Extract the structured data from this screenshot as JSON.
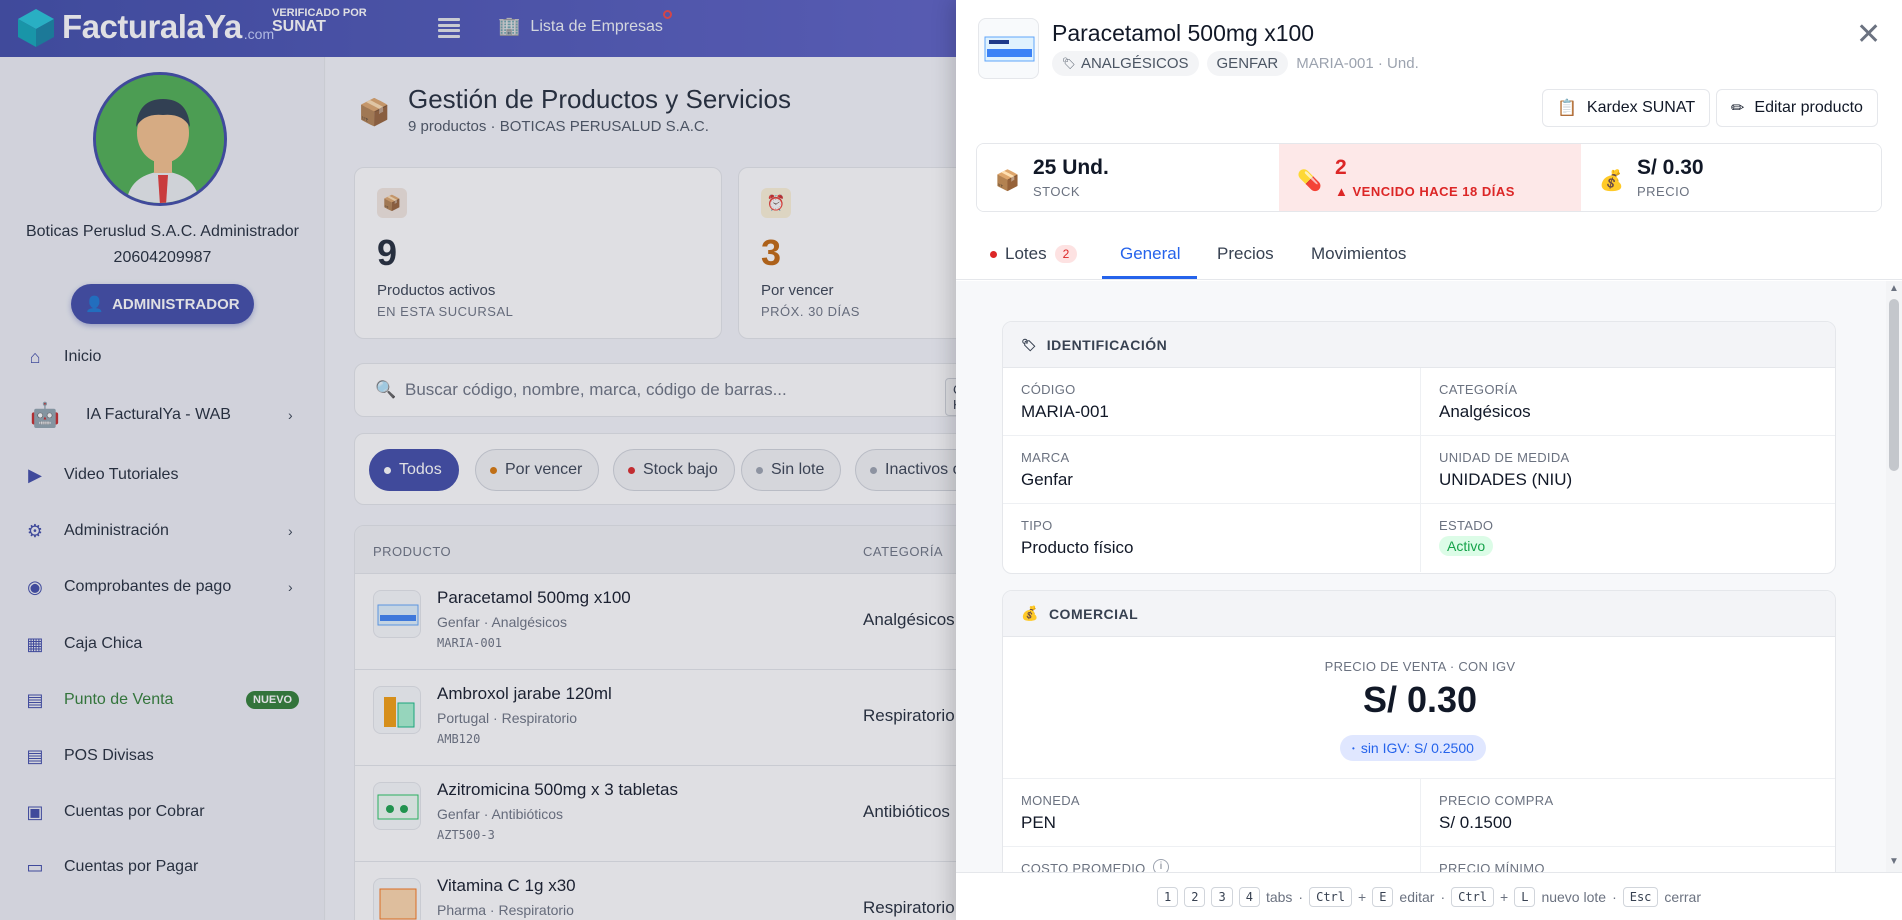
{
  "brand": {
    "name": "FacturalaYa",
    "suffix": ".com",
    "verified_line1": "VERIFICADO POR",
    "verified_line2": "SUNAT"
  },
  "topbar": {
    "empresas_label": "Lista de Empresas"
  },
  "sidebar": {
    "company_name": "Boticas Peruslud S.A.C. Administrador",
    "ruc": "20604209987",
    "role_button": "ADMINISTRADOR",
    "items": [
      {
        "label": "Inicio",
        "icon": "home-icon"
      },
      {
        "label": "IA FacturalYa - WAB",
        "icon": "robot-icon"
      },
      {
        "label": "Video Tutoriales",
        "icon": "video-icon"
      },
      {
        "label": "Administración",
        "icon": "gear-icon"
      },
      {
        "label": "Comprobantes de pago",
        "icon": "eye-icon"
      },
      {
        "label": "Caja Chica",
        "icon": "calculator-icon"
      },
      {
        "label": "Punto de Venta",
        "icon": "store-icon",
        "badge": "NUEVO"
      },
      {
        "label": "POS Divisas",
        "icon": "store-icon"
      },
      {
        "label": "Cuentas por Cobrar",
        "icon": "cash-icon"
      },
      {
        "label": "Cuentas por Pagar",
        "icon": "card-icon"
      }
    ]
  },
  "main": {
    "title": "Gestión de Productos y Servicios",
    "subtitle": "9 productos · BOTICAS PERUSALUD S.A.C.",
    "kpis": [
      {
        "value": "9",
        "label": "Productos activos",
        "sub": "EN ESTA SUCURSAL",
        "color": "#1f2937"
      },
      {
        "value": "3",
        "label": "Por vencer",
        "sub": "PRÓX. 30 DÍAS",
        "color": "#c2660a"
      }
    ],
    "search_placeholder": "Buscar código, nombre, marca, código de barras...",
    "search_shortcut": "Ctrl K",
    "filters": [
      {
        "label": "Todos",
        "dot": "#ffffff",
        "active": true
      },
      {
        "label": "Por vencer",
        "dot": "#d97706"
      },
      {
        "label": "Stock bajo",
        "dot": "#dc2626"
      },
      {
        "label": "Sin lote",
        "dot": "#9ca3af"
      },
      {
        "label": "Inactivos o",
        "dot": "#9ca3af"
      }
    ],
    "table": {
      "headers": [
        "PRODUCTO",
        "CATEGORÍA"
      ],
      "rows": [
        {
          "name": "Paracetamol 500mg x100",
          "meta": "Genfar · Analgésicos",
          "code": "MARIA-001",
          "category": "Analgésicos"
        },
        {
          "name": "Ambroxol jarabe 120ml",
          "meta": "Portugal · Respiratorio",
          "code": "AMB120",
          "category": "Respiratorio"
        },
        {
          "name": "Azitromicina 500mg x 3 tabletas",
          "meta": "Genfar · Antibióticos",
          "code": "AZT500-3",
          "category": "Antibióticos"
        },
        {
          "name": "Vitamina C 1g x30",
          "meta": "Pharma · Respiratorio",
          "code": "",
          "category": "Respiratorio"
        }
      ]
    }
  },
  "panel": {
    "title": "Paracetamol 500mg x100",
    "tags": [
      "ANALGÉSICOS",
      "GENFAR"
    ],
    "code_unit": "MARIA-001 · Und.",
    "kardex_button": "Kardex SUNAT",
    "edit_button": "Editar producto",
    "stats": [
      {
        "value": "25 Und.",
        "label": "STOCK",
        "icon": "box-icon"
      },
      {
        "value": "2",
        "label": "▲ VENCIDO HACE 18 DÍAS",
        "icon": "pill-icon"
      },
      {
        "value": "S/ 0.30",
        "label": "PRECIO",
        "icon": "money-bag-icon"
      }
    ],
    "tabs": [
      {
        "label": "Lotes",
        "badge": "2"
      },
      {
        "label": "General"
      },
      {
        "label": "Precios"
      },
      {
        "label": "Movimientos"
      }
    ],
    "identificacion": {
      "title": "IDENTIFICACIÓN",
      "fields": [
        {
          "label": "CÓDIGO",
          "value": "MARIA-001"
        },
        {
          "label": "CATEGORÍA",
          "value": "Analgésicos"
        },
        {
          "label": "MARCA",
          "value": "Genfar"
        },
        {
          "label": "UNIDAD DE MEDIDA",
          "value": "UNIDADES (NIU)"
        },
        {
          "label": "TIPO",
          "value": "Producto físico"
        },
        {
          "label": "ESTADO",
          "value": "Activo"
        }
      ]
    },
    "comercial": {
      "title": "COMERCIAL",
      "price_label": "PRECIO DE VENTA · CON IGV",
      "price_value": "S/ 0.30",
      "price_no_igv": "sin IGV: S/ 0.2500",
      "fields": [
        {
          "label": "MONEDA",
          "value": "PEN"
        },
        {
          "label": "PRECIO COMPRA",
          "value": "S/ 0.1500"
        },
        {
          "label": "COSTO PROMEDIO",
          "value": ""
        },
        {
          "label": "PRECIO MÍNIMO",
          "value": ""
        }
      ]
    },
    "footer": {
      "keys": [
        "1",
        "2",
        "3",
        "4"
      ],
      "tabs_text": "tabs",
      "ctrl": "Ctrl",
      "e_key": "E",
      "edit_text": "editar",
      "l_key": "L",
      "lote_text": "nuevo lote",
      "esc_key": "Esc",
      "close_text": "cerrar"
    }
  }
}
